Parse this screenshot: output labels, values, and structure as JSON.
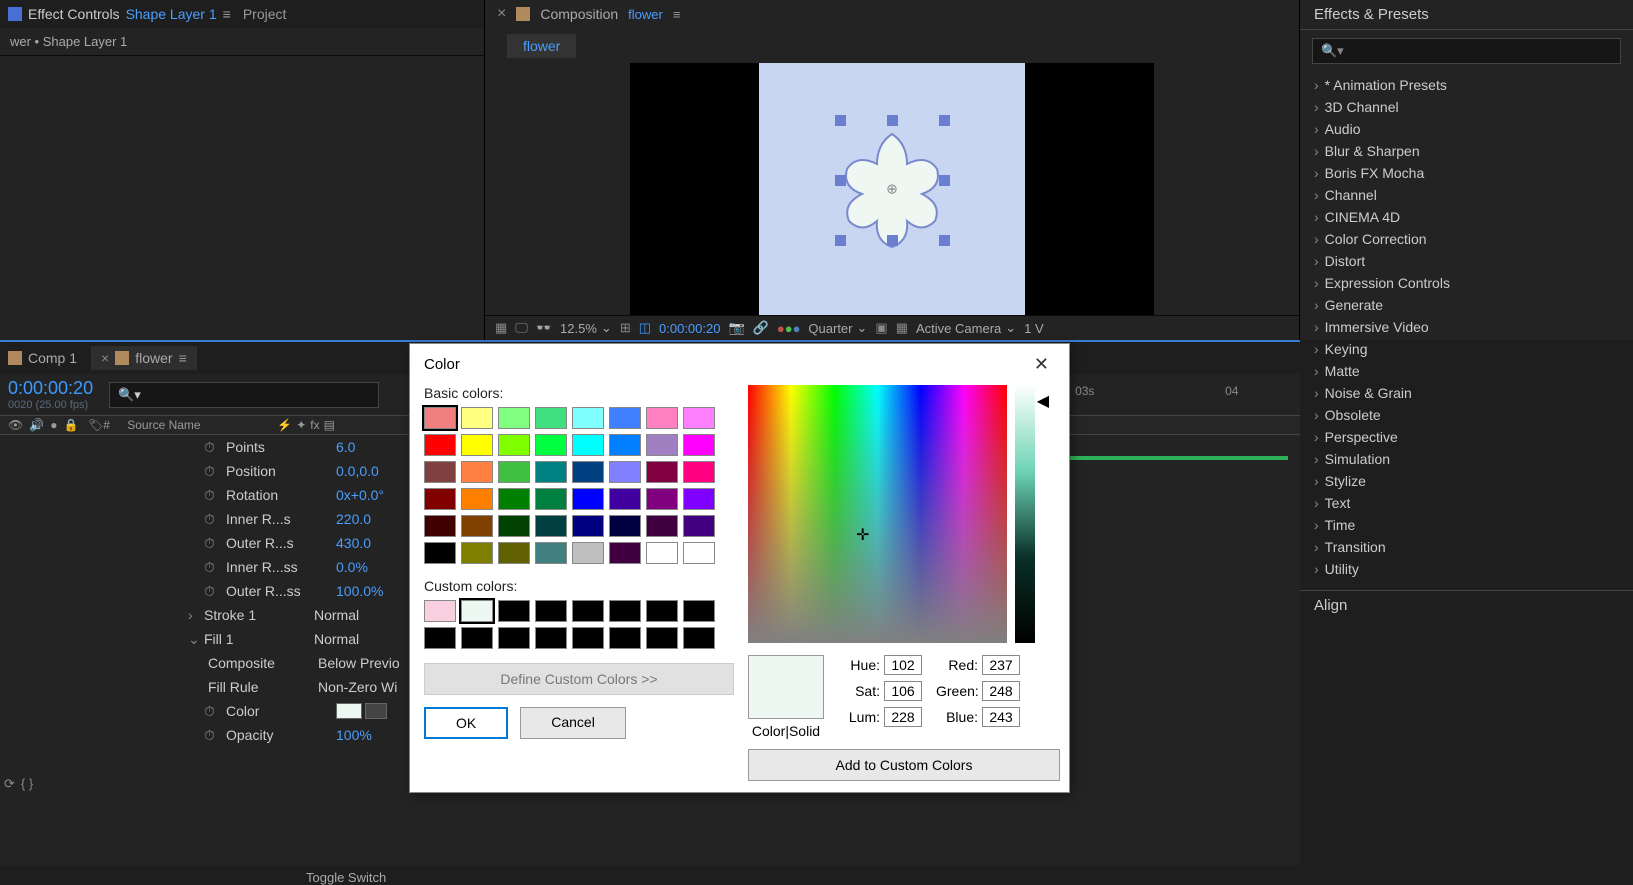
{
  "effectControls": {
    "tabLabel": "Effect Controls",
    "layerName": "Shape Layer 1",
    "projectTab": "Project",
    "breadcrumb": "wer • Shape Layer 1"
  },
  "composition": {
    "tabPrefix": "Composition",
    "compName": "flower",
    "subtab": "flower",
    "zoom": "12.5%",
    "time": "0:00:00:20",
    "quality": "Quarter",
    "camera": "Active Camera",
    "views": "1 V"
  },
  "effectsPresets": {
    "title": "Effects & Presets",
    "searchPlaceholder": "",
    "items": [
      "* Animation Presets",
      "3D Channel",
      "Audio",
      "Blur & Sharpen",
      "Boris FX Mocha",
      "Channel",
      "CINEMA 4D",
      "Color Correction",
      "Distort",
      "Expression Controls",
      "Generate",
      "Immersive Video",
      "Keying",
      "Matte",
      "Noise & Grain",
      "Obsolete",
      "Perspective",
      "Simulation",
      "Stylize",
      "Text",
      "Time",
      "Transition",
      "Utility"
    ],
    "alignTitle": "Align"
  },
  "timeline": {
    "tab1": "Comp 1",
    "tab2": "flower",
    "time": "0:00:00:20",
    "fps": "0020 (25.00 fps)",
    "sourceNameHeader": "Source Name",
    "rulerMarks": [
      "03s",
      "04"
    ],
    "props": [
      {
        "label": "Points",
        "value": "6.0",
        "stopwatch": true
      },
      {
        "label": "Position",
        "value": "0.0,0.0",
        "stopwatch": true
      },
      {
        "label": "Rotation",
        "value": "0x+0.0°",
        "stopwatch": true
      },
      {
        "label": "Inner R...s",
        "value": "220.0",
        "stopwatch": true
      },
      {
        "label": "Outer R...s",
        "value": "430.0",
        "stopwatch": true
      },
      {
        "label": "Inner R...ss",
        "value": "0.0%",
        "stopwatch": true
      },
      {
        "label": "Outer R...ss",
        "value": "100.0%",
        "stopwatch": true
      }
    ],
    "stroke": {
      "label": "Stroke 1",
      "mode": "Normal"
    },
    "fill": {
      "label": "Fill 1",
      "mode": "Normal"
    },
    "composite": {
      "label": "Composite",
      "value": "Below Previo"
    },
    "fillRule": {
      "label": "Fill Rule",
      "value": "Non-Zero Wi"
    },
    "color": {
      "label": "Color"
    },
    "opacity": {
      "label": "Opacity",
      "value": "100%"
    },
    "toggleSwitches": "Toggle Switch"
  },
  "colorDialog": {
    "title": "Color",
    "basicLabel": "Basic colors:",
    "customLabel": "Custom colors:",
    "defineBtn": "Define Custom Colors >>",
    "okBtn": "OK",
    "cancelBtn": "Cancel",
    "colorSolidLabel": "Color|Solid",
    "addCustomBtn": "Add to Custom Colors",
    "hueLabel": "Hue:",
    "satLabel": "Sat:",
    "lumLabel": "Lum:",
    "redLabel": "Red:",
    "greenLabel": "Green:",
    "blueLabel": "Blue:",
    "hue": "102",
    "sat": "106",
    "lum": "228",
    "red": "237",
    "green": "248",
    "blue": "243",
    "basicColors": [
      "#f08080",
      "#ffff80",
      "#80ff80",
      "#40e080",
      "#80ffff",
      "#4080ff",
      "#ff80c0",
      "#ff80ff",
      "#ff0000",
      "#ffff00",
      "#80ff00",
      "#00ff40",
      "#00ffff",
      "#0080ff",
      "#a080c0",
      "#ff00ff",
      "#804040",
      "#ff8040",
      "#40c040",
      "#008080",
      "#004080",
      "#8080ff",
      "#800040",
      "#ff0080",
      "#800000",
      "#ff8000",
      "#008000",
      "#008040",
      "#0000ff",
      "#4000a0",
      "#800080",
      "#8000ff",
      "#400000",
      "#804000",
      "#004000",
      "#004040",
      "#000080",
      "#000040",
      "#400040",
      "#400080",
      "#000000",
      "#808000",
      "#606000",
      "#408080",
      "#c0c0c0",
      "#400040",
      "#ffffff",
      "#ffffff"
    ],
    "customColors": [
      "#f8d0e0",
      "#edf8f3",
      "#000000",
      "#000000",
      "#000000",
      "#000000",
      "#000000",
      "#000000",
      "#000000",
      "#000000",
      "#000000",
      "#000000",
      "#000000",
      "#000000",
      "#000000",
      "#000000"
    ]
  }
}
